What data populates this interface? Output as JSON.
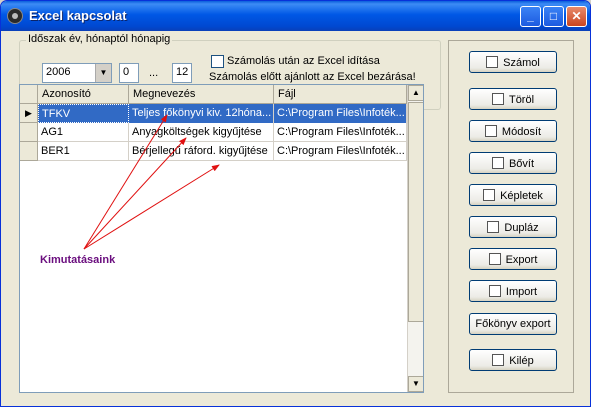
{
  "window": {
    "title": "Excel kapcsolat",
    "minimize": "_",
    "maximize": "□",
    "close": "✕"
  },
  "period": {
    "label": "Időszak év, hónaptól hónapig",
    "year": "2006",
    "month_from": "0",
    "separator": "...",
    "month_to": "12",
    "open_excel_label": "Számolás után az Excel idítása",
    "warning": "Számolás előtt ajánlott az Excel bezárása!"
  },
  "grid": {
    "headers": [
      "Azonosító",
      "Megnevezés",
      "Fájl"
    ],
    "rows": [
      {
        "id": "TFKV",
        "name": "Teljes főkönyvi kiv. 12hóna...",
        "file": "C:\\Program Files\\Infoték..."
      },
      {
        "id": "AG1",
        "name": "Anyagköltségek kigyűjtése",
        "file": "C:\\Program Files\\Infoték..."
      },
      {
        "id": "BER1",
        "name": "Bérjellegű ráford. kigyűjtése",
        "file": "C:\\Program Files\\Infoték..."
      }
    ]
  },
  "annotation": "Kimutatásaink",
  "buttons": {
    "szamol": "Számol",
    "torol": "Töröl",
    "modosit": "Módosít",
    "bovit": "Bővít",
    "kepletek": "Képletek",
    "dupla": "Dupláz",
    "export": "Export",
    "import": "Import",
    "fokonyv_export": "Főkönyv export",
    "kilep": "Kilép"
  },
  "colors": {
    "annotation": "#6a0d7e",
    "arrows": "#e01010",
    "selection": "#316ac5"
  }
}
